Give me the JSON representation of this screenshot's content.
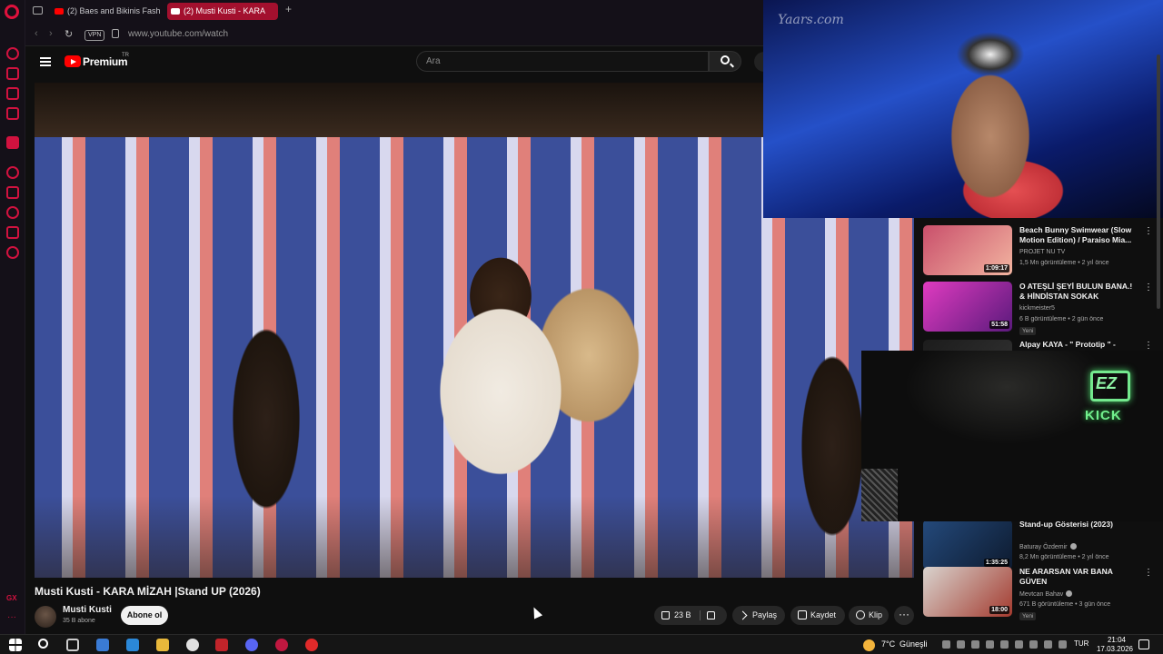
{
  "browser": {
    "tabs": [
      {
        "label": "(2) Baes and Bikinis Fashio",
        "active": false
      },
      {
        "label": "(2) Musti Kusti - KARA",
        "active": true
      }
    ],
    "new_tab_label": "+",
    "vpn_label": "VPN",
    "url": "www.youtube.com/watch",
    "rail_gx_label": "GX",
    "rail_more_label": "···",
    "accent_color": "#d1123f"
  },
  "masthead": {
    "brand": "Premium",
    "country_code": "TR",
    "search_placeholder": "Ara"
  },
  "video": {
    "title": "Musti Kusti - KARA MİZAH  |Stand UP (2026)",
    "channel": "Musti Kusti",
    "subscribers": "35 B abone",
    "subscribe_label": "Abone ol",
    "like_count": "23 B",
    "share_label": "Paylaş",
    "save_label": "Kaydet",
    "clip_label": "Klip",
    "more_label": "···"
  },
  "pip_top": {
    "watermark": "Yaars.com"
  },
  "recommendations": [
    {
      "title": "Beach Bunny Swimwear (Slow Motion Edition) / Paraiso Mia...",
      "channel": "PROJET NU TV",
      "meta": "1,5 Mn görüntüleme • 2 yıl önce",
      "duration": "1:09:17",
      "badge": "",
      "verified": false,
      "thumb_colors": [
        "#c94f6b",
        "#f2b4a0"
      ]
    },
    {
      "title": "O ATEŞLİ ŞEYİ BULUN BANA.! & HİNDİSTAN SOKAK LEZZETLE...",
      "channel": "kickmeister5",
      "meta": "6 B görüntüleme • 2 gün önce",
      "duration": "51:58",
      "badge": "Yeni",
      "verified": false,
      "thumb_colors": [
        "#e03bc0",
        "#5a1a7c"
      ]
    },
    {
      "title": "Alpay KAYA - \" Prototip \" -",
      "channel": "",
      "meta": "",
      "duration": "",
      "badge": "",
      "verified": false,
      "thumb_colors": [
        "#1c1c1c",
        "#333333"
      ]
    },
    {
      "title": "Stand-up Gösterisi (2023)",
      "channel": "Baturay Özdemir",
      "meta": "8,2 Mn görüntüleme • 2 yıl önce",
      "duration": "1:35:25",
      "badge": "",
      "verified": true,
      "thumb_colors": [
        "#244a7c",
        "#0d1a2e"
      ]
    },
    {
      "title": "NE ARARSAN VAR BANA GÜVEN",
      "channel": "Mevtcan Bahav",
      "meta": "671 B görüntüleme • 3 gün önce",
      "duration": "18:00",
      "badge": "Yeni",
      "verified": true,
      "thumb_colors": [
        "#d9d4cf",
        "#a33a2e"
      ]
    }
  ],
  "stream": {
    "logo_text": "EZ",
    "platform_text": "KICK"
  },
  "taskbar": {
    "weather_temp": "7°C",
    "weather_desc": "Güneşli",
    "language": "TUR",
    "time": "21:04",
    "date": "17.03.2026",
    "app_colors": [
      "#3a7bd5",
      "#2b88d8",
      "#e8b83b",
      "#e0e0e0",
      "#c0242a",
      "#5865f2",
      "#c01840",
      "#e02a2a"
    ]
  }
}
